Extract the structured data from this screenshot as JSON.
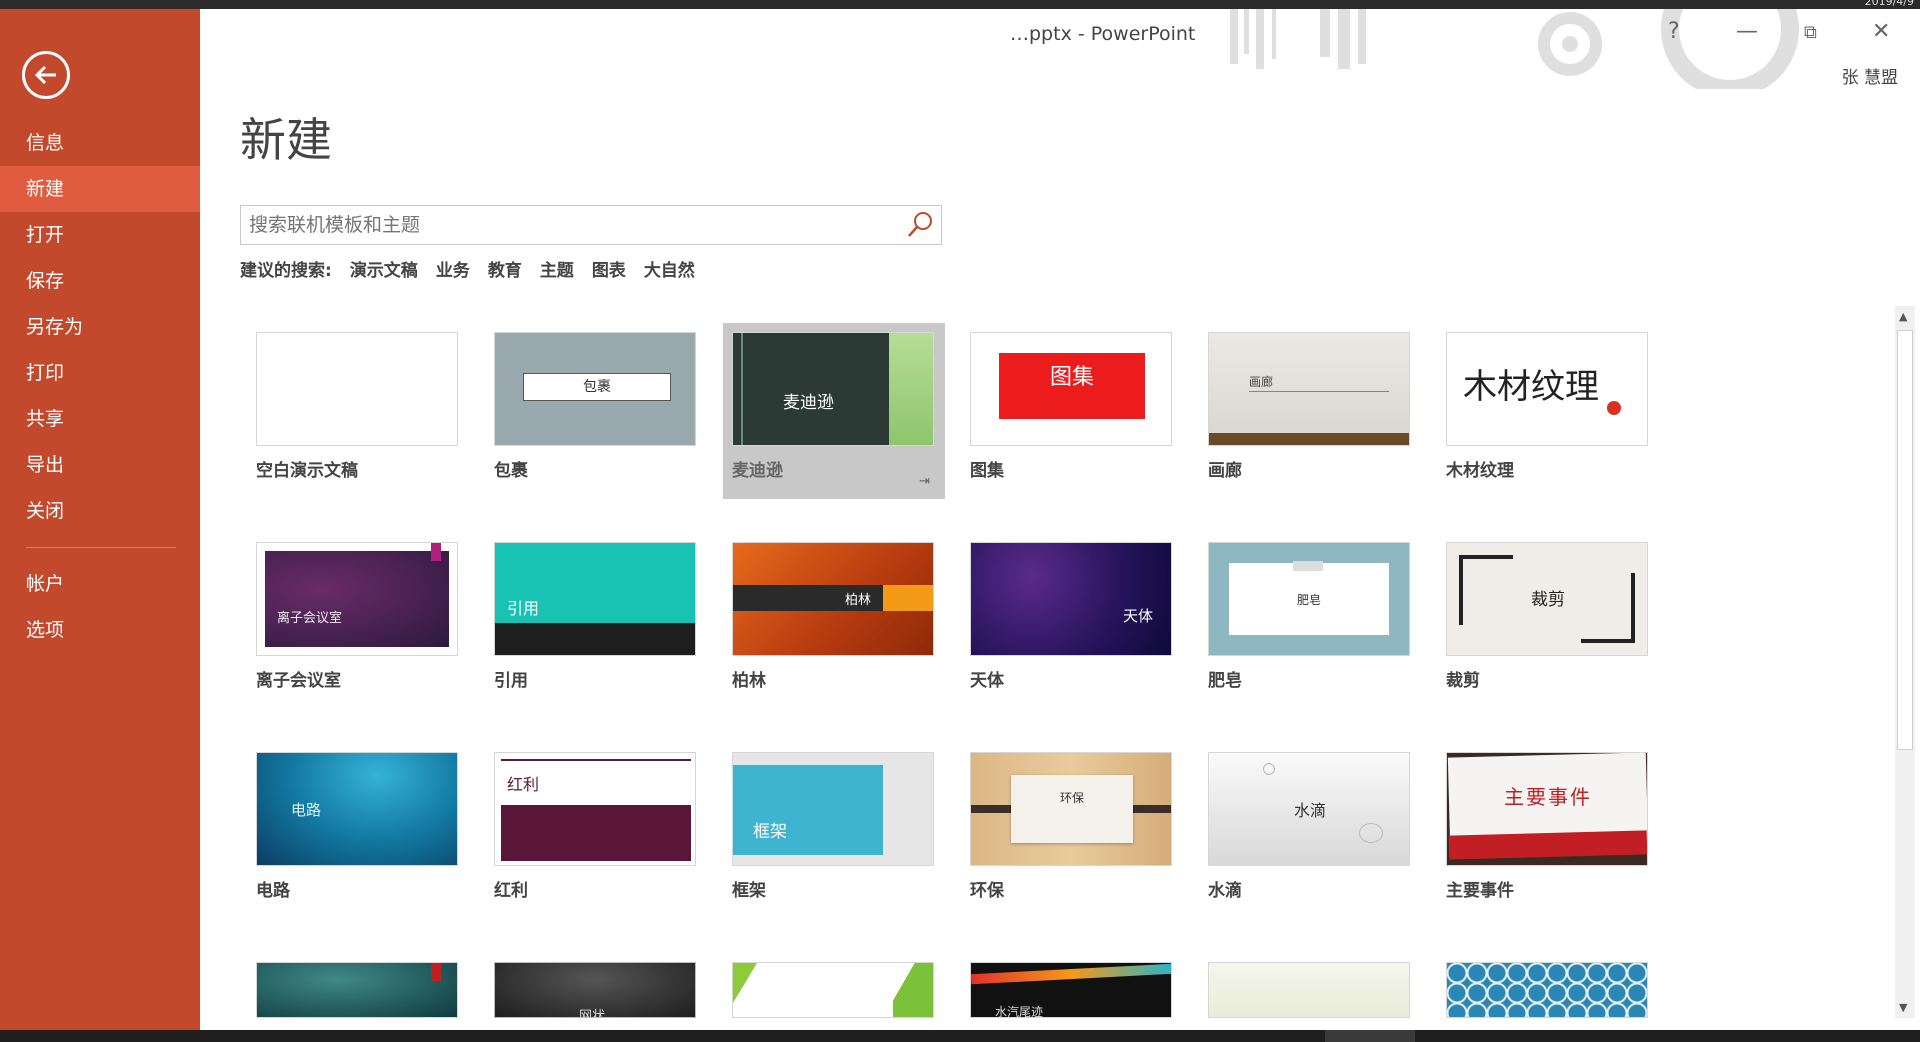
{
  "window": {
    "doc_title": "…pptx - PowerPoint",
    "help": "?",
    "minimize": "—",
    "restore": "⧉",
    "close": "✕",
    "username": "张 慧盟",
    "date": "2019/4/9"
  },
  "sidebar": {
    "back_icon": "back-arrow-icon",
    "items": [
      {
        "label": "信息"
      },
      {
        "label": "新建",
        "active": true
      },
      {
        "label": "打开"
      },
      {
        "label": "保存"
      },
      {
        "label": "另存为"
      },
      {
        "label": "打印"
      },
      {
        "label": "共享"
      },
      {
        "label": "导出"
      },
      {
        "label": "关闭"
      }
    ],
    "bottom_items": [
      {
        "label": "帐户"
      },
      {
        "label": "选项"
      }
    ]
  },
  "main": {
    "title": "新建",
    "search": {
      "placeholder": "搜索联机模板和主题"
    },
    "suggest_label": "建议的搜索:",
    "suggestions": [
      "演示文稿",
      "业务",
      "教育",
      "主题",
      "图表",
      "大自然"
    ],
    "templates": [
      {
        "name": "空白演示文稿",
        "thumb_text": ""
      },
      {
        "name": "包裹",
        "thumb_text": "包裹"
      },
      {
        "name": "麦迪逊",
        "thumb_text": "麦迪逊"
      },
      {
        "name": "图集",
        "thumb_text": "图集"
      },
      {
        "name": "画廊",
        "thumb_text": "画廊"
      },
      {
        "name": "木材纹理",
        "thumb_text": "木材纹理"
      },
      {
        "name": "离子会议室",
        "thumb_text": "离子会议室"
      },
      {
        "name": "引用",
        "thumb_text": "引用"
      },
      {
        "name": "柏林",
        "thumb_text": "柏林"
      },
      {
        "name": "天体",
        "thumb_text": "天体"
      },
      {
        "name": "肥皂",
        "thumb_text": "肥皂"
      },
      {
        "name": "裁剪",
        "thumb_text": "裁剪"
      },
      {
        "name": "电路",
        "thumb_text": "电路"
      },
      {
        "name": "红利",
        "thumb_text": "红利"
      },
      {
        "name": "框架",
        "thumb_text": "框架"
      },
      {
        "name": "环保",
        "thumb_text": "环保"
      },
      {
        "name": "水滴",
        "thumb_text": "水滴"
      },
      {
        "name": "主要事件",
        "thumb_text": "主要事件"
      },
      {
        "name": "",
        "thumb_text": ""
      },
      {
        "name": "",
        "thumb_text": "网状"
      },
      {
        "name": "",
        "thumb_text": ""
      },
      {
        "name": "",
        "thumb_text": "水汽尾迹"
      },
      {
        "name": "",
        "thumb_text": ""
      },
      {
        "name": "",
        "thumb_text": ""
      }
    ],
    "selected_template": "麦迪逊",
    "pin_icon": "pin-icon"
  }
}
